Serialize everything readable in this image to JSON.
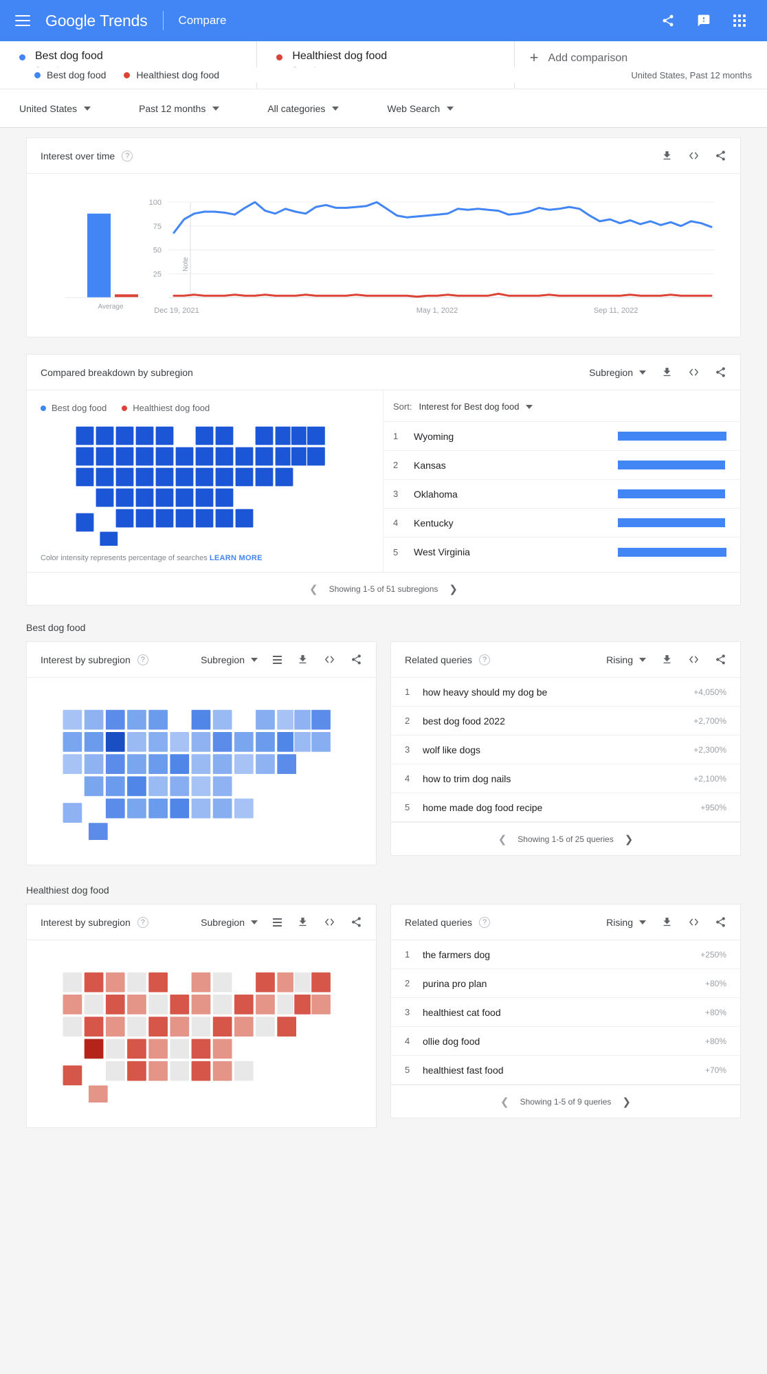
{
  "appbar": {
    "menu_icon": "hamburger-menu-icon",
    "brand_google": "Google",
    "brand_trends": "Trends",
    "compare": "Compare",
    "share_icon": "share-icon",
    "feedback_icon": "feedback-icon",
    "apps_icon": "apps-grid-icon",
    "brand_color": "#4285f4"
  },
  "ghost": {
    "term1": "Best dog food",
    "term2": "Healthiest dog food",
    "meta": "United States, Past 12 months"
  },
  "terms": [
    {
      "title": "Best dog food",
      "subtitle": "Search term",
      "color": "#4285f4"
    },
    {
      "title": "Healthiest dog food",
      "subtitle": "Search term",
      "color": "#db4437"
    }
  ],
  "add_comparison": {
    "label": "Add comparison",
    "plus": "+"
  },
  "filters": [
    {
      "label": "United States"
    },
    {
      "label": "Past 12 months"
    },
    {
      "label": "All categories"
    },
    {
      "label": "Web Search"
    }
  ],
  "interest_over_time": {
    "title": "Interest over time",
    "help": "?",
    "download_icon": "download-icon",
    "embed_icon": "embed-code-icon",
    "share_icon": "share-icon"
  },
  "compared_breakdown": {
    "title": "Compared breakdown by subregion",
    "selector": "Subregion",
    "legend": [
      {
        "label": "Best dog food",
        "color": "#4285f4"
      },
      {
        "label": "Healthiest dog food",
        "color": "#db4437"
      }
    ],
    "map_note_text": "Color intensity represents percentage of searches",
    "map_note_link": "LEARN MORE",
    "sort_label": "Sort:",
    "sort_value": "Interest for Best dog food",
    "rows": [
      {
        "rank": "1",
        "name": "Wyoming",
        "value": 100
      },
      {
        "rank": "2",
        "name": "Kansas",
        "value": 99
      },
      {
        "rank": "3",
        "name": "Oklahoma",
        "value": 99
      },
      {
        "rank": "4",
        "name": "Kentucky",
        "value": 99
      },
      {
        "rank": "5",
        "name": "West Virginia",
        "value": 100
      }
    ],
    "pager": "Showing 1-5 of 51 subregions"
  },
  "term_sections": [
    {
      "heading": "Best dog food",
      "map_card": {
        "title": "Interest by subregion",
        "help": "?",
        "selector": "Subregion",
        "list_icon": "list-view-icon",
        "download_icon": "download-icon",
        "embed_icon": "embed-code-icon",
        "share_icon": "share-icon"
      },
      "queries_card": {
        "title": "Related queries",
        "help": "?",
        "selector": "Rising",
        "rows": [
          {
            "rank": "1",
            "query": "how heavy should my dog be",
            "change": "+4,050%"
          },
          {
            "rank": "2",
            "query": "best dog food 2022",
            "change": "+2,700%"
          },
          {
            "rank": "3",
            "query": "wolf like dogs",
            "change": "+2,300%"
          },
          {
            "rank": "4",
            "query": "how to trim dog nails",
            "change": "+2,100%"
          },
          {
            "rank": "5",
            "query": "home made dog food recipe",
            "change": "+950%"
          }
        ],
        "pager": "Showing 1-5 of 25 queries"
      }
    },
    {
      "heading": "Healthiest dog food",
      "map_card": {
        "title": "Interest by subregion",
        "help": "?",
        "selector": "Subregion",
        "list_icon": "list-view-icon",
        "download_icon": "download-icon",
        "embed_icon": "embed-code-icon",
        "share_icon": "share-icon"
      },
      "queries_card": {
        "title": "Related queries",
        "help": "?",
        "selector": "Rising",
        "rows": [
          {
            "rank": "1",
            "query": "the farmers dog",
            "change": "+250%"
          },
          {
            "rank": "2",
            "query": "purina pro plan",
            "change": "+80%"
          },
          {
            "rank": "3",
            "query": "healthiest cat food",
            "change": "+80%"
          },
          {
            "rank": "4",
            "query": "ollie dog food",
            "change": "+80%"
          },
          {
            "rank": "5",
            "query": "healthiest fast food",
            "change": "+70%"
          }
        ],
        "pager": "Showing 1-5 of 9 queries"
      }
    }
  ],
  "chart_data": {
    "type": "line",
    "title": "Interest over time",
    "xlabel": "",
    "ylabel": "",
    "ylim": [
      0,
      108
    ],
    "yticks": [
      25,
      50,
      75,
      100
    ],
    "xticks": [
      "Dec 19, 2021",
      "May 1, 2022",
      "Sep 11, 2022"
    ],
    "annotation": "Note",
    "average_bar": {
      "label": "Average",
      "series": [
        {
          "name": "Best dog food",
          "value": 88,
          "color": "#4285f4"
        },
        {
          "name": "Healthiest dog food",
          "value": 2,
          "color": "#db4437"
        }
      ]
    },
    "series": [
      {
        "name": "Best dog food",
        "color": "#4285f4",
        "values": [
          68,
          82,
          88,
          90,
          90,
          89,
          87,
          94,
          100,
          91,
          88,
          93,
          90,
          88,
          95,
          97,
          94,
          94,
          95,
          96,
          100,
          93,
          86,
          84,
          85,
          86,
          87,
          88,
          93,
          92,
          93,
          92,
          91,
          87,
          88,
          90,
          94,
          92,
          93,
          95,
          93,
          86,
          80,
          82,
          78,
          81,
          77,
          80,
          76,
          79,
          75,
          80,
          78,
          74
        ]
      },
      {
        "name": "Healthiest dog food",
        "color": "#db4437",
        "values": [
          2,
          2,
          3,
          2,
          2,
          2,
          3,
          2,
          2,
          3,
          2,
          2,
          2,
          3,
          2,
          2,
          2,
          2,
          3,
          2,
          2,
          2,
          2,
          2,
          1,
          2,
          2,
          3,
          2,
          2,
          2,
          2,
          4,
          2,
          2,
          2,
          2,
          3,
          2,
          2,
          2,
          2,
          2,
          2,
          2,
          3,
          2,
          2,
          2,
          3,
          2,
          2,
          2,
          2
        ]
      }
    ]
  }
}
